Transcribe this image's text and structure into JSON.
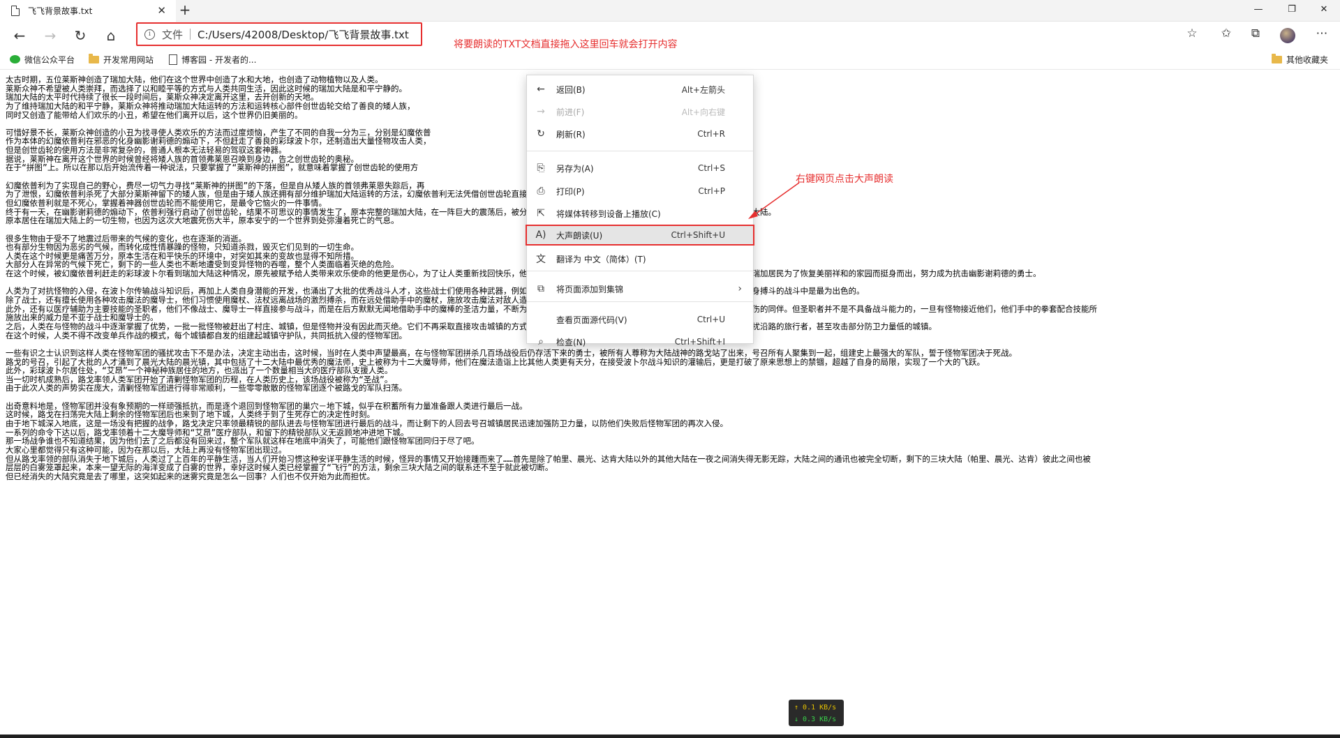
{
  "tab": {
    "title": "飞飞背景故事.txt",
    "close_glyph": "✕",
    "new_glyph": "+"
  },
  "window": {
    "minimize": "—",
    "restore": "❐",
    "close": "✕"
  },
  "address": {
    "scheme_label": "文件",
    "url": "C:/Users/42008/Desktop/飞飞背景故事.txt"
  },
  "annotations": {
    "drag_hint": "将要朗读的TXT文档直接拖入这里回车就会打开内容",
    "right_click_hint": "右键网页点击大声朗读",
    "color": "#e62e2e"
  },
  "favorites": {
    "items": [
      "微信公众平台",
      "开发常用网站",
      "博客园 - 开发者的..."
    ],
    "other": "其他收藏夹"
  },
  "content_lines": [
    "太古时期，五位莱斯神创造了瑞加大陆，他们在这个世界中创造了水和大地，也创造了动物植物以及人类。",
    "莱斯众神不希望被人类崇拜，而选择了以和睦平等的方式与人类共同生活，因此这时候的瑞加大陆是和平宁静的。",
    "瑞加大陆的太平时代持续了很长一段时间后，莱斯众神决定离开这里，去开创新的天地。",
    "为了维持瑞加大陆的和平宁静，莱斯众神将推动瑞加大陆运转的方法和运转核心部件创世齿轮交给了善良的矮人族，",
    "同时又创造了能带给人们欢乐的小丑，希望在他们离开以后，这个世界仍旧美丽的。",
    "",
    "可惜好景不长，莱斯众神创造的小丑为找寻使人类欢乐的方法而过度烦恼，产生了不同的自我一分为三，分别是幻魔依普",
    "作为本体的幻魔依普利在邪恶的化身幽影谢莉德的煽动下，不但赶走了善良的彩球波卜尔，还制造出大量怪物攻击人类，",
    "但是创世齿轮的使用方法是非常复杂的，普通人根本无法轻易的驾驭这套神器。",
    "据说，莱斯神在离开这个世界的时候曾经将矮人族的首领弗莱恩召唤到身边，告之创世齿轮的奥秘。",
    "在于“拼图”上。所以在那以后开始流传着一种说法，只要掌握了“莱斯神的拼图”，就意味着掌握了创世齿轮的使用方",
    "",
    "幻魔依普利为了实现自己的野心，费尽一切气力寻找“莱斯神的拼图”的下落，但是自从矮人族的首领弗莱恩失踪后，再",
    "为了泄恨，幻魔依普利杀死了大部分莱斯神留下的矮人族，但是由于矮人族还拥有部分维护瑞加大陆运转的方法，幻魔依普利无法凭借创世齿轮直接操控瑞加大陆，只能依靠残存的矮人维持着这片世界。",
    "但幻魔依普利就是不死心，掌握着神器创世齿轮而不能使用它，是最令它恼火的一件事情。",
    "终于有一天，在幽影谢莉德的煽动下，依普利强行启动了创世齿轮，结果不可思议的事情发生了，原本完整的瑞加大陆，在一阵巨大的震荡后，被分离出来的大陆渐渐的飘离到世界的各个角落，成为一块块独立的大陆。",
    "原本居住在瑞加大陆上的一切生物，也因为这次大地震死伤大半，原本安宁的一个世界到处弥漫着死亡的气息。",
    "",
    "很多生物由于受不了地震过后带来的气候的变化，也在逐渐的消逝。",
    "也有部分生物因为恶劣的气候，而转化成性情暴躁的怪物，只知道杀戮，毁灭它们见到的一切生命。",
    "人类在这个时候更是痛苦万分，原本生活在和平快乐的环境中，对突如其来的变故也显得不知所措。",
    "大部分人在异常的气候下死亡，剩下的一些人类也不断地遭受到变异怪物的吞噬，整个人类面临着灭绝的危险。",
    "在这个时候，被幻魔依普利赶走的彩球波卜尔看到瑞加大陆这种情况，原先被赋予给人类带来欢乐使命的他更是伤心，为了让人类重新找回快乐，他决定将自己所知道的怪物的知识慢慢灌输给人类，让原本纯朴的瑞加居民为了恢复美丽祥和的家园而挺身而出，努力成为抗击幽影谢莉德的勇士。",
    "",
    "人类为了对抗怪物的入侵，在波卜尔传输战斗知识后，再加上人类自身潜能的开发，也涌出了大批的优秀战斗人才，这些战士们使用各种武器，例如剑、斧头等武器进行战斗，加上各种战斗技能配合，在与怪物近身搏斗的战斗中是最为出色的。",
    "除了战士，还有擅长使用各种攻击魔法的魔导士，他们习惯使用魔杖、法杖远离战场的激烈搏杀，而在远处借助手中的魔杖，施放攻击魔法对敌人造成巨大的伤害，是战场上最为有力的攻击力量。",
    "此外，还有以医疗辅助为主要技能的圣职者，他们不像战士、魔导士一样直接参与战斗，而是在后方默默无闻地借助手中的魔棒的圣洁力量，不断为战场上自己的同伴实施强有力的加持防护魔法，并且迅速医治受伤的同伴。但圣职者并不是不具备战斗能力的，一旦有怪物接近他们，他们手中的拳套配合技能所",
    "施放出来的威力是不亚于战士和魔导士的。",
    "之后，人类在与怪物的战斗中逐渐掌握了优势，一批一批怪物被赶出了村庄、城镇，但是怪物并没有因此而灭绝。它们不再采取直接攻击城镇的方式，而聚集在一起成为各种各样的怪物军团，不断的在城镇周围骚扰沿路的旅行者，甚至攻击部分防卫力量低的城镇。",
    "在这个时候，人类不得不改变单兵作战的模式，每个城镇都自发的组建起城镇守护队，共同抵抗入侵的怪物军团。",
    "",
    "一些有识之士认识到这样人类在怪物军团的骚扰攻击下不是办法，决定主动出击，这时候，当时在人类中声望最高，在与怪物军团拼杀几百场战役后仍存活下来的勇士，被所有人尊称为大陆战神的路戈站了出来，号召所有人聚集到一起，组建史上最强大的军队，誓于怪物军团决于死战。",
    "路戈的号召，引起了大批的人才涌到了晨光大陆的晨光镇，其中包括了十二大陆中最优秀的魔法师，史上被称为十二大魔导师，他们在魔法造诣上比其他人类更有天分，在接受波卜尔战斗知识的灌输后，更是打破了原来思想上的禁锢，超越了自身的局限，实现了一个大的飞跃。",
    "此外，彩球波卜尔居住处，“艾昂”一个神秘种族居住的地方，也派出了一个数量相当大的医疗部队支援人类。",
    "当一切时机成熟后，路戈率领人类军团开始了清剿怪物军团的历程，在人类历史上，该场战役被称为“圣战”。",
    "由于此次人类的声势实在庞大，清剿怪物军团进行得非常顺利，一些零零散散的怪物军团逐个被路戈的军队扫荡。",
    "",
    "出奇意料地是，怪物军团并没有象预期的一样顽强抵抗，而是逐个退回到怪物军团的巢穴－地下城，似乎在积蓄所有力量准备跟人类进行最后一战。",
    "这时候，路戈在扫荡完大陆上剩余的怪物军团后也来到了地下城，人类终于到了生死存亡的决定性时刻。",
    "由于地下城深入地底，这是一场没有把握的战争，路戈决定只率领最精锐的部队进去与怪物军团进行最后的战斗，而让剩下的人回去号召城镇居民迅速加强防卫力量，以防他们失败后怪物军团的再次入侵。",
    "一系列的命令下达以后，路戈率领着十二大魔导师和“艾昂”医疗部队，和留下的精锐部队义无返顾地冲进地下城。",
    "那一场战争谁也不知道结果，因为他们去了之后都没有回来过，整个军队就这样在地底中消失了，可能他们跟怪物军团同归于尽了吧。",
    "大家心里都觉得只有这种可能，因为在那以后，大陆上再没有怪物军团出现过。",
    "但从路戈率领的部队消失于地下城后，人类过了上百年的平静生活，当人们开始习惯这种安详平静生活的时候，怪异的事情又开始接踵而来了……首先是除了帕里、晨光、达肯大陆以外的其他大陆在一夜之间消失得无影无踪，大陆之间的通讯也被完全切断，剩下的三块大陆（帕里、晨光、达肯）彼此之间也被",
    "层层的白雾笼罩起来，本来一望无际的海洋变成了白雾的世界，幸好这时候人类已经掌握了“飞行”的方法，剩余三块大陆之间的联系还不至于就此被切断。",
    "但已经消失的大陆究竟是去了哪里，这突如起来的迷雾究竟是怎么一回事？人们也不仅开始为此而担忧。"
  ],
  "context_menu": [
    {
      "label": "返回(B)",
      "shortcut": "Alt+左箭头",
      "disabled": false
    },
    {
      "label": "前进(F)",
      "shortcut": "Alt+向右键",
      "disabled": true
    },
    {
      "label": "刷新(R)",
      "shortcut": "Ctrl+R",
      "disabled": false
    },
    {
      "label": "另存为(A)",
      "shortcut": "Ctrl+S",
      "disabled": false
    },
    {
      "label": "打印(P)",
      "shortcut": "Ctrl+P",
      "disabled": false
    },
    {
      "label": "将媒体转移到设备上播放(C)",
      "shortcut": "",
      "disabled": false
    },
    {
      "label": "大声朗读(U)",
      "shortcut": "Ctrl+Shift+U",
      "disabled": false,
      "highlighted": true
    },
    {
      "label": "翻译为 中文（简体）(T)",
      "shortcut": "",
      "disabled": false
    },
    {
      "label": "将页面添加到集锦",
      "shortcut": "",
      "disabled": false,
      "submenu": true
    },
    {
      "label": "查看页面源代码(V)",
      "shortcut": "Ctrl+U",
      "disabled": false
    },
    {
      "label": "检查(N)",
      "shortcut": "Ctrl+Shift+I",
      "disabled": false
    }
  ],
  "speed": {
    "up": "↑ 0.1 KB/s",
    "down": "↓ 0.3 KB/s"
  }
}
